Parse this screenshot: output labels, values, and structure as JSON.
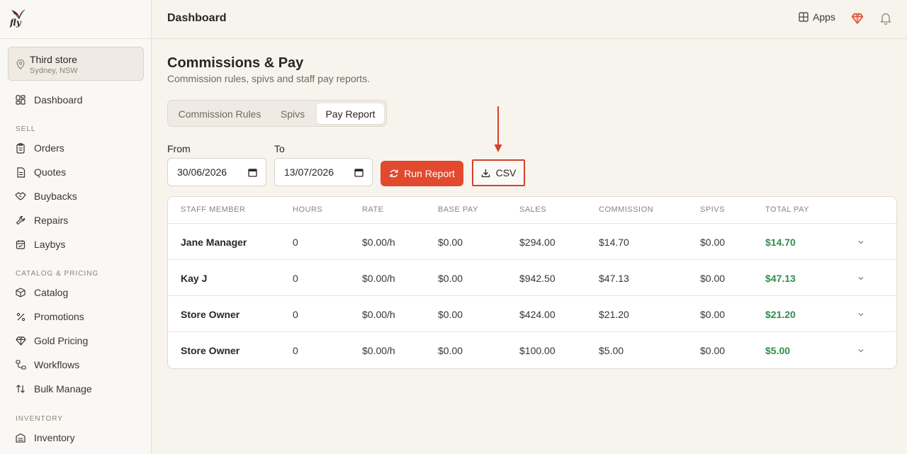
{
  "brand": {
    "name": "fly",
    "accent": "#e2492e",
    "success": "#2f8f4a"
  },
  "header": {
    "title": "Dashboard",
    "apps_label": "Apps"
  },
  "store": {
    "name": "Third store",
    "location": "Sydney, NSW"
  },
  "sidebar": {
    "dashboard": "Dashboard",
    "sell_label": "SELL",
    "orders": "Orders",
    "quotes": "Quotes",
    "buybacks": "Buybacks",
    "repairs": "Repairs",
    "laybys": "Laybys",
    "catalog_label": "CATALOG & PRICING",
    "catalog": "Catalog",
    "promotions": "Promotions",
    "gold_pricing": "Gold Pricing",
    "workflows": "Workflows",
    "bulk_manage": "Bulk Manage",
    "inventory_label": "INVENTORY",
    "inventory": "Inventory"
  },
  "page": {
    "title": "Commissions & Pay",
    "subtitle": "Commission rules, spivs and staff pay reports."
  },
  "tabs": [
    "Commission Rules",
    "Spivs",
    "Pay Report"
  ],
  "active_tab": "Pay Report",
  "filters": {
    "from_label": "From",
    "from_value": "30/06/2026",
    "to_label": "To",
    "to_value": "13/07/2026",
    "run_label": "Run Report",
    "csv_label": "CSV"
  },
  "table": {
    "headers": [
      "STAFF MEMBER",
      "HOURS",
      "RATE",
      "BASE PAY",
      "SALES",
      "COMMISSION",
      "SPIVS",
      "TOTAL PAY"
    ],
    "rows": [
      [
        "Jane Manager",
        "0",
        "$0.00/h",
        "$0.00",
        "$294.00",
        "$14.70",
        "$0.00",
        "$14.70"
      ],
      [
        "Kay J",
        "0",
        "$0.00/h",
        "$0.00",
        "$942.50",
        "$47.13",
        "$0.00",
        "$47.13"
      ],
      [
        "Store Owner",
        "0",
        "$0.00/h",
        "$0.00",
        "$424.00",
        "$21.20",
        "$0.00",
        "$21.20"
      ],
      [
        "Store Owner",
        "0",
        "$0.00/h",
        "$0.00",
        "$100.00",
        "$5.00",
        "$0.00",
        "$5.00"
      ]
    ]
  }
}
